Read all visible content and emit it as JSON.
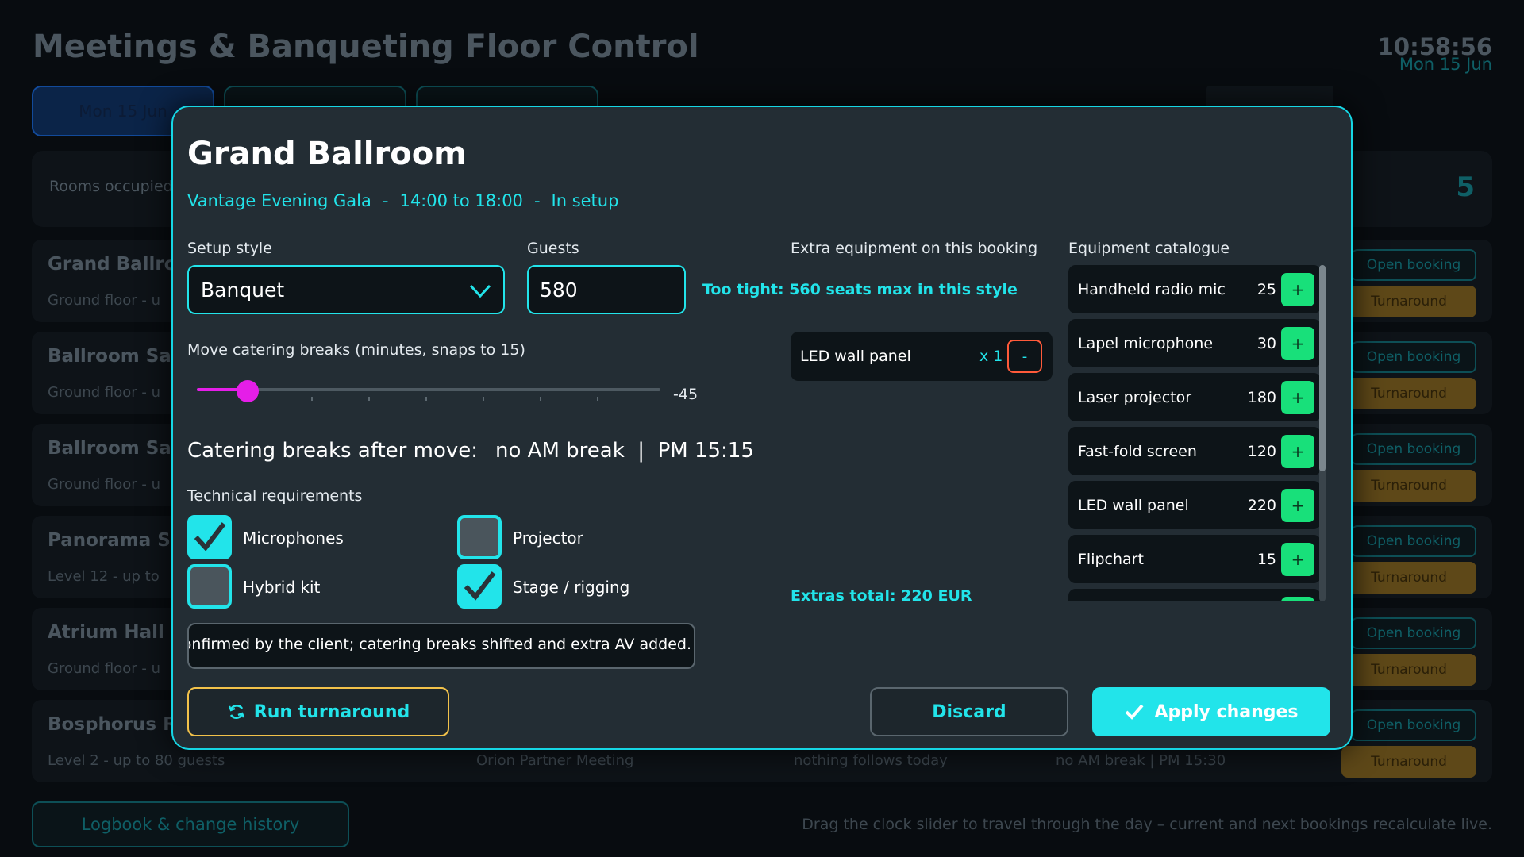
{
  "app": {
    "title": "Meetings & Banqueting Floor Control",
    "clock_time": "10:58:56",
    "clock_date": "Mon 15 Jun"
  },
  "date_tabs": [
    "Mon 15 Jun",
    "",
    ""
  ],
  "stats": {
    "label": "Rooms occupied",
    "count": "5"
  },
  "rooms": [
    {
      "name": "Grand Ballroom",
      "sub": "Ground floor  -  u",
      "open": "Open booking",
      "turn": "Turnaround"
    },
    {
      "name": "Ballroom Salo",
      "sub": "Ground floor  -  u",
      "open": "Open booking",
      "turn": "Turnaround"
    },
    {
      "name": "Ballroom Salo",
      "sub": "Ground floor  -  u",
      "open": "Open booking",
      "turn": "Turnaround"
    },
    {
      "name": "Panorama Sui",
      "sub": "Level 12  -  up to",
      "open": "Open booking",
      "turn": "Turnaround"
    },
    {
      "name": "Atrium Hall",
      "sub": "Ground floor  -  u",
      "open": "Open booking",
      "turn": "Turnaround"
    },
    {
      "name": "Bosphorus Ro",
      "sub": "Level 2  -  up to 80 guests",
      "booking": "Orion Partner Meeting",
      "next": "nothing follows today",
      "breaks": "no AM break  |  PM 15:30",
      "open": "Open booking",
      "turn": "Turnaround"
    }
  ],
  "footer": {
    "logbook_label": "Logbook & change history",
    "hint": "Drag the clock slider to travel through the day – current and next bookings recalculate live."
  },
  "modal": {
    "title": "Grand Ballroom",
    "booking": "Vantage Evening Gala",
    "time": "14:00 to 18:00",
    "status": "In setup",
    "setup_style_label": "Setup style",
    "setup_style_value": "Banquet",
    "guests_label": "Guests",
    "guests_value": "580",
    "guest_warning": "Too tight: 560 seats max in this style",
    "breaks_slider_label": "Move catering breaks (minutes, snaps to 15)",
    "breaks_slider_value": "-45",
    "breaks_slider_fraction": 0.11,
    "breaks_prefix": "Catering breaks after move:",
    "breaks_am": "no AM break",
    "breaks_pm": "PM 15:15",
    "tech_label": "Technical requirements",
    "tech": [
      {
        "label": "Microphones",
        "checked": true
      },
      {
        "label": "Projector",
        "checked": false
      },
      {
        "label": "Hybrid kit",
        "checked": false
      },
      {
        "label": "Stage / rigging",
        "checked": true
      }
    ],
    "notes": "ınt confirmed by the client; catering breaks shifted and extra AV added.",
    "turnaround_label": "Run turnaround",
    "discard_label": "Discard",
    "apply_label": "Apply changes",
    "extras_label": "Extra equipment on this booking",
    "extras": [
      {
        "name": "LED wall panel",
        "qty": "x 1",
        "remove": "-"
      }
    ],
    "extras_total": "Extras total: 220 EUR",
    "catalogue_label": "Equipment catalogue",
    "catalogue": [
      {
        "name": "Handheld radio mic",
        "price": "25",
        "add": "+"
      },
      {
        "name": "Lapel microphone",
        "price": "30",
        "add": "+"
      },
      {
        "name": "Laser projector",
        "price": "180",
        "add": "+"
      },
      {
        "name": "Fast-fold screen",
        "price": "120",
        "add": "+"
      },
      {
        "name": "LED wall panel",
        "price": "220",
        "add": "+"
      },
      {
        "name": "Flipchart",
        "price": "15",
        "add": "+"
      },
      {
        "name": "",
        "price": "",
        "add": ""
      }
    ]
  },
  "colors": {
    "accent": "#22e4ea",
    "slider": "#e51ee8",
    "add": "#18e07a",
    "warning_border": "#f2c24a",
    "remove_border": "#ff5a3a"
  }
}
